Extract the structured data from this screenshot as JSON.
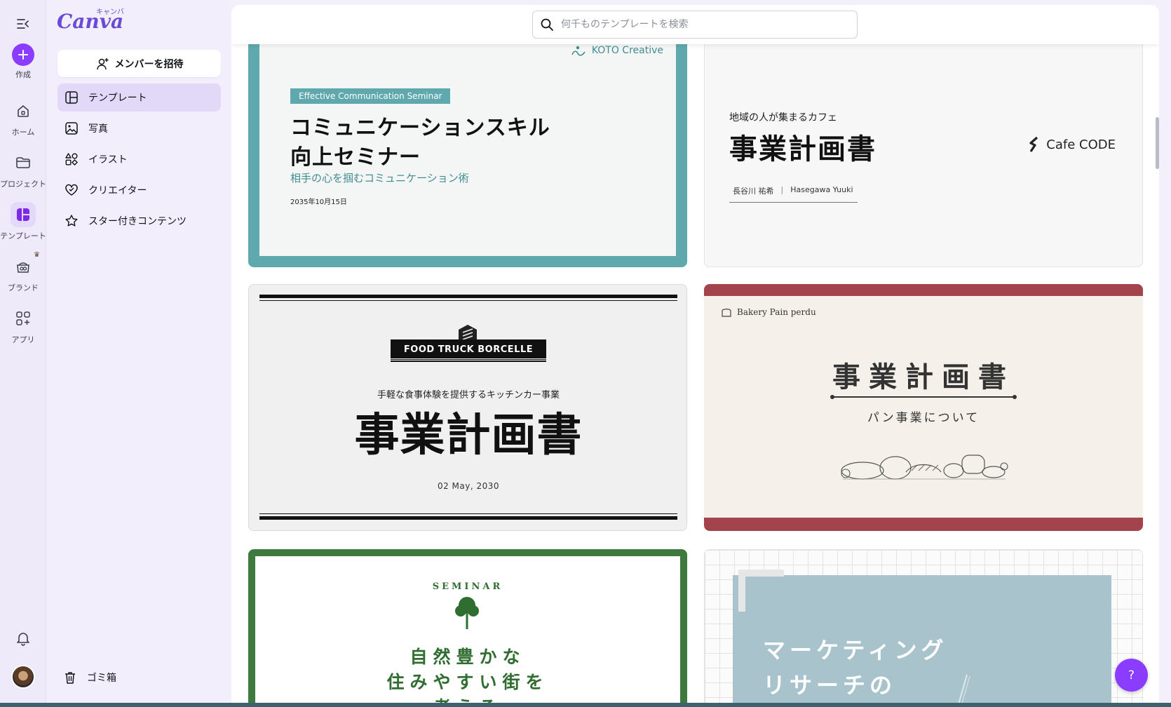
{
  "rail": {
    "create": "作成",
    "home": "ホーム",
    "projects": "プロジェクト",
    "templates": "テンプレート",
    "brand": "ブランド",
    "apps": "アプリ"
  },
  "logo": {
    "main": "Canva",
    "kana": "キャンバ"
  },
  "panel": {
    "invite": "メンバーを招待",
    "items": [
      {
        "label": "テンプレート",
        "icon": "template-icon",
        "active": true
      },
      {
        "label": "写真",
        "icon": "photo-icon"
      },
      {
        "label": "イラスト",
        "icon": "shapes-icon"
      },
      {
        "label": "クリエイター",
        "icon": "creator-heart-icon"
      },
      {
        "label": "スター付きコンテンツ",
        "icon": "star-icon"
      }
    ],
    "trash": "ゴミ箱"
  },
  "search": {
    "placeholder": "何千ものテンプレートを検索",
    "value": ""
  },
  "templates": {
    "t1": {
      "brand": "KOTO Creative",
      "tag": "Effective Communication Seminar",
      "title_line1": "コミュニケーションスキル",
      "title_line2": "向上セミナー",
      "subtitle": "相手の心を掴むコミュニケーション術",
      "date": "2035年10月15日",
      "colors": {
        "frame": "#5fa8ad",
        "inner": "#f4f5f5"
      }
    },
    "t2": {
      "kicker": "地域の人が集まるカフェ",
      "title": "事業計画書",
      "brand": "Cafe CODE",
      "name_jp": "長谷川 祐希",
      "name_en": "Hasegawa Yuuki"
    },
    "t3": {
      "brand": "FOOD TRUCK BORCELLE",
      "kicker": "手軽な食事体験を提供するキッチンカー事業",
      "title": "事業計画書",
      "date": "02 May, 2030"
    },
    "t4": {
      "brand": "Bakery Pain perdu",
      "title": "事業計画書",
      "subtitle": "パン事業について",
      "colors": {
        "band": "#a3444c",
        "bg": "#f5f1ea"
      }
    },
    "t5": {
      "kicker": "SEMINAR",
      "line1": "自然豊かな",
      "line2": "住みやすい街を",
      "line3": "考える",
      "colors": {
        "frame": "#3e7a3e",
        "text": "#2f6d30"
      }
    },
    "t6": {
      "line1": "マーケティング",
      "line2": "リサーチの",
      "colors": {
        "panel": "#a9c3cc"
      }
    }
  },
  "help": "?"
}
